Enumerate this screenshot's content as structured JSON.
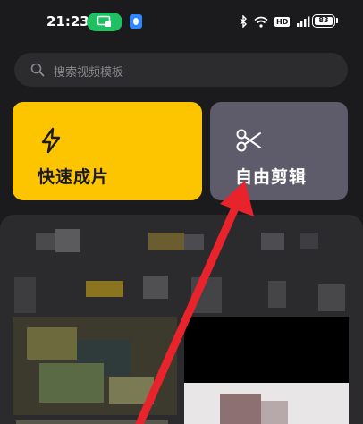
{
  "status_bar": {
    "time": "21:23",
    "battery": "83",
    "hd_label": "HD",
    "icons": [
      "screen-share-icon",
      "app-notification-icon",
      "bluetooth-icon",
      "wifi-icon",
      "hd-icon",
      "signal-icon",
      "battery-icon"
    ]
  },
  "search": {
    "placeholder": "搜索视频模板",
    "icon": "search-icon"
  },
  "actions": {
    "quick": {
      "label": "快速成片",
      "icon": "lightning-icon",
      "color": "#fdc400"
    },
    "free": {
      "label": "自由剪辑",
      "icon": "scissors-icon",
      "color": "#5e5b6b"
    }
  },
  "annotation": {
    "type": "arrow",
    "color": "#e8232b",
    "target": "自由剪辑"
  },
  "colors": {
    "background": "#1b1b1d",
    "accent_green": "#1fc061",
    "panel": "#2b2b2e"
  }
}
